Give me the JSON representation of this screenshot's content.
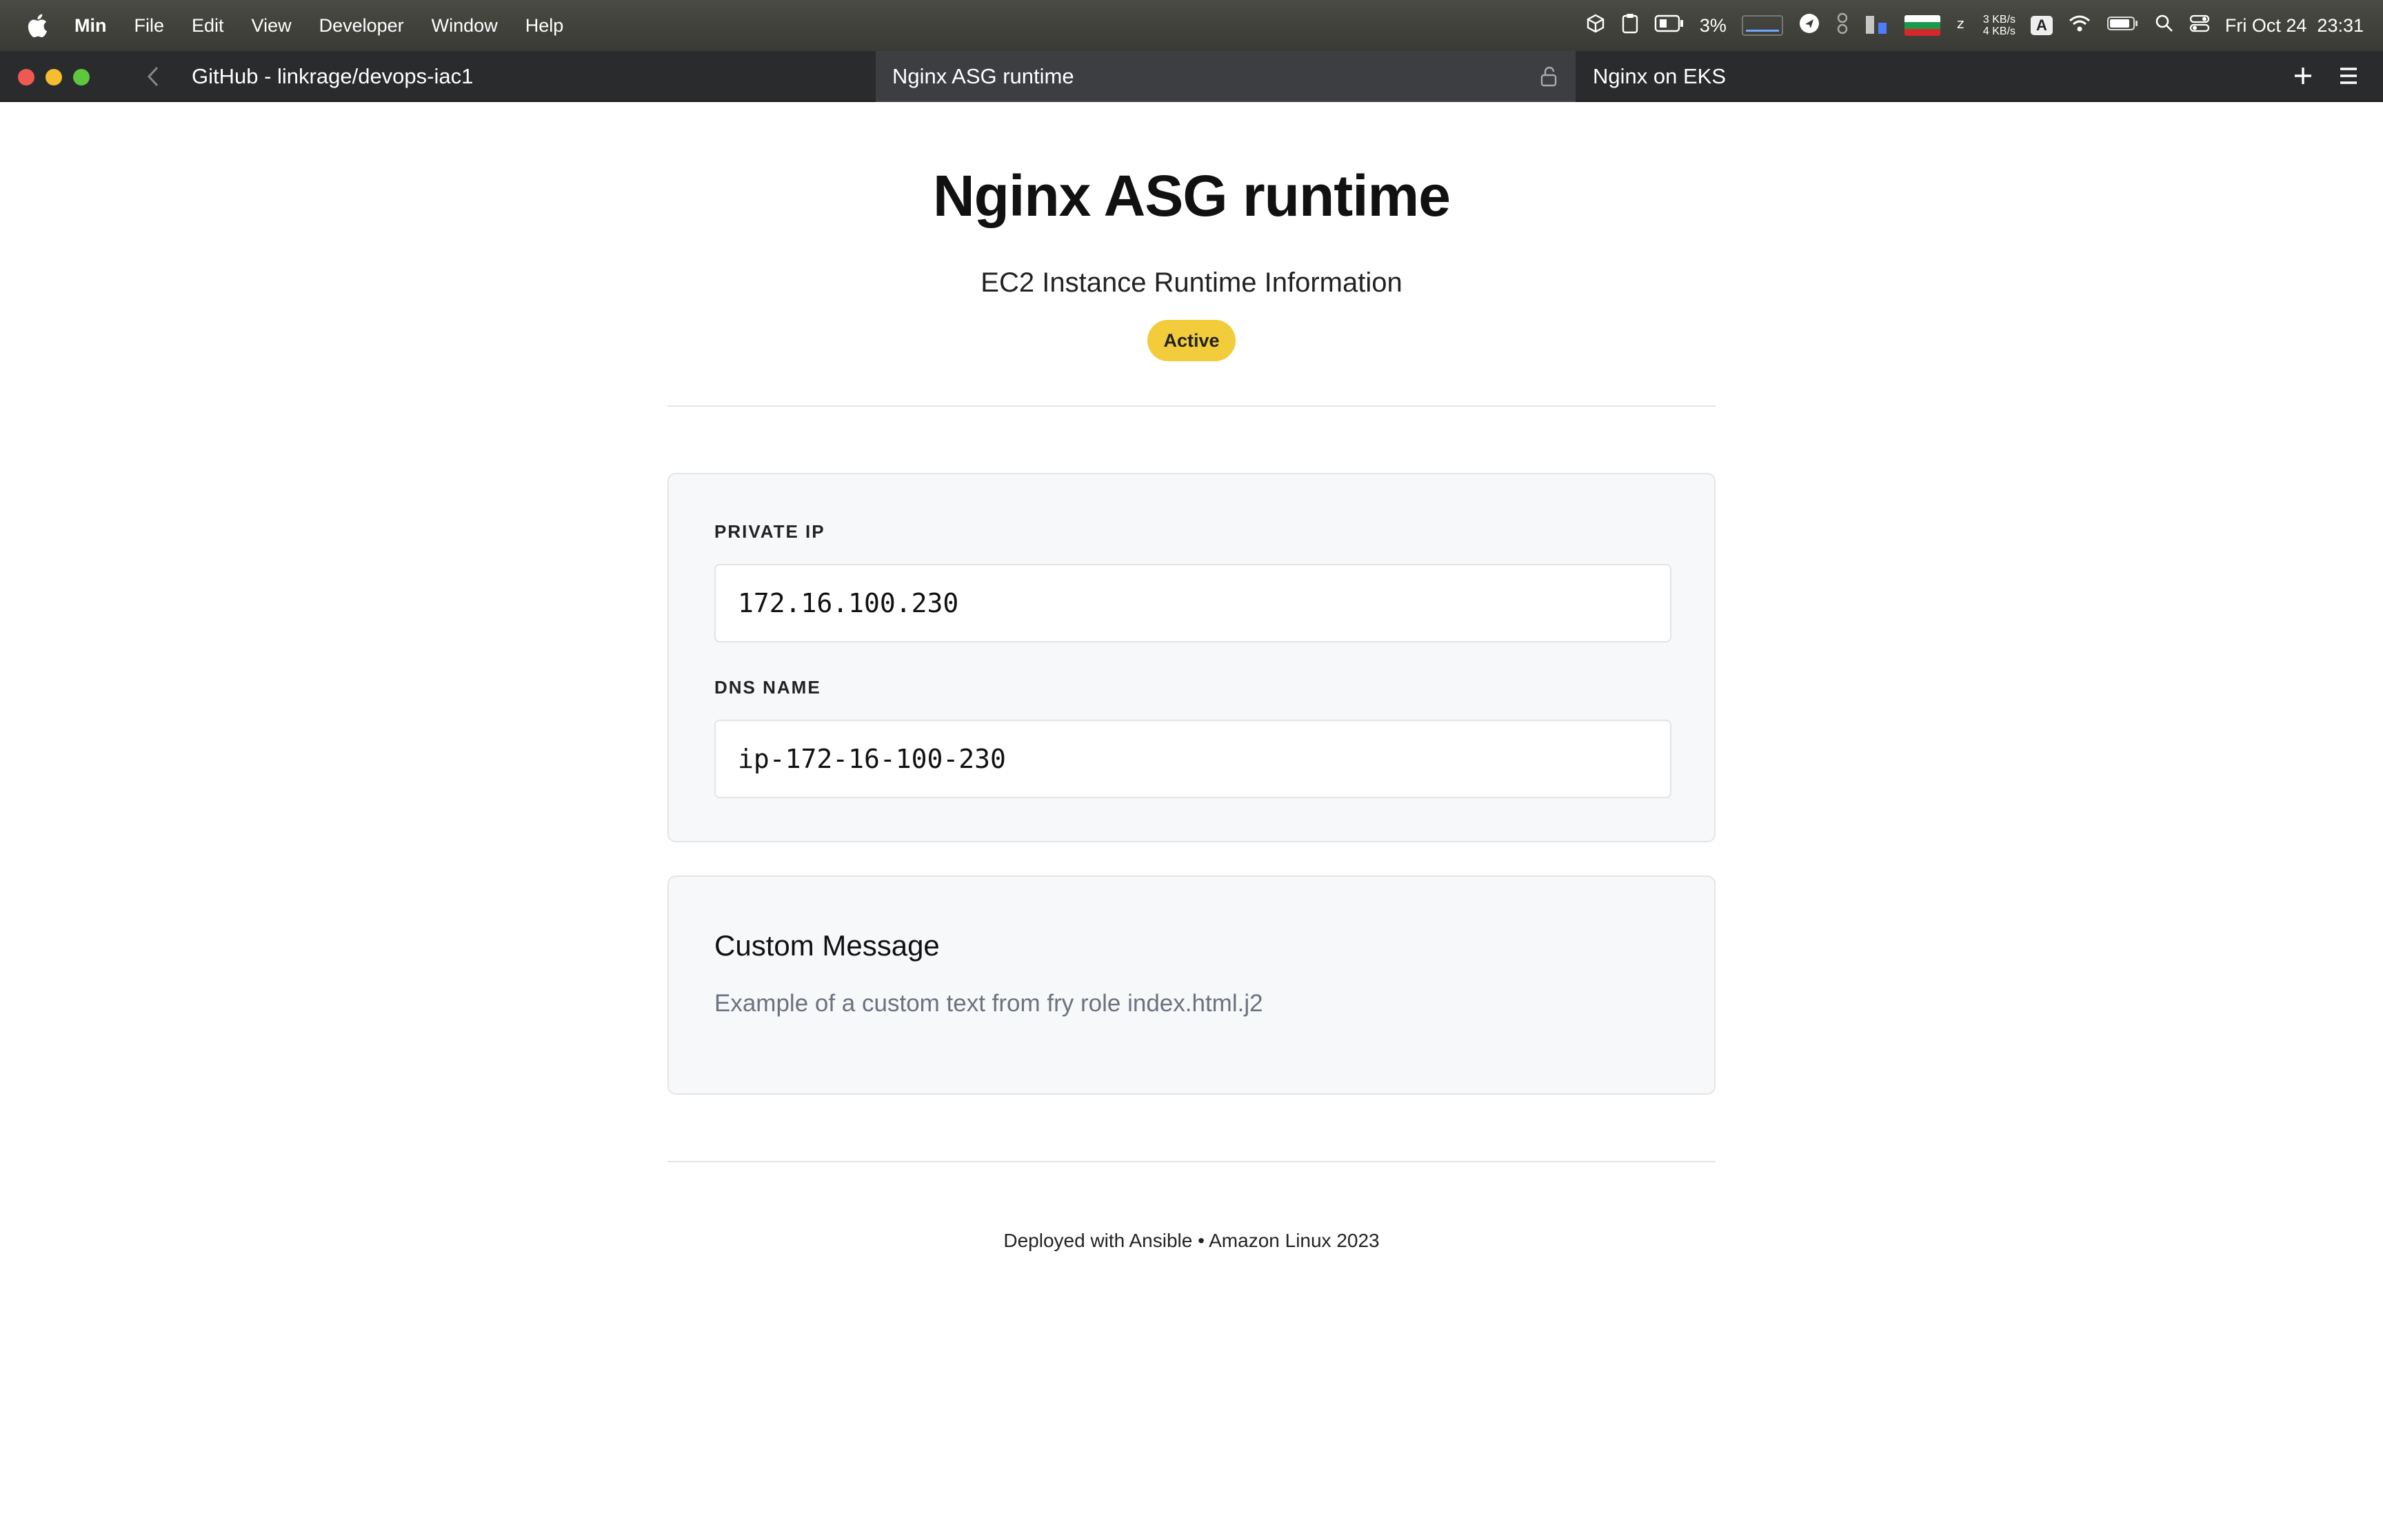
{
  "menubar": {
    "app_name": "Min",
    "items": [
      "File",
      "Edit",
      "View",
      "Developer",
      "Window",
      "Help"
    ],
    "cpu": "3%",
    "net_up": "3 KB/s",
    "net_down": "4 KB/s",
    "input_source": "A",
    "datetime": "Fri Oct 24  23:31"
  },
  "browser": {
    "tabs": [
      {
        "title": "GitHub - linkrage/devops-iac1",
        "active": false
      },
      {
        "title": "Nginx ASG runtime",
        "active": true
      },
      {
        "title": "Nginx on EKS",
        "active": false
      }
    ]
  },
  "page": {
    "title": "Nginx ASG runtime",
    "subtitle": "EC2 Instance Runtime Information",
    "status": "Active",
    "status_color": "#f2cc3a",
    "fields": [
      {
        "label": "PRIVATE IP",
        "value": "172.16.100.230"
      },
      {
        "label": "DNS NAME",
        "value": "ip-172-16-100-230"
      }
    ],
    "message": {
      "title": "Custom Message",
      "body": "Example of a custom text from fry role index.html.j2"
    },
    "footer": "Deployed with Ansible • Amazon Linux 2023"
  }
}
